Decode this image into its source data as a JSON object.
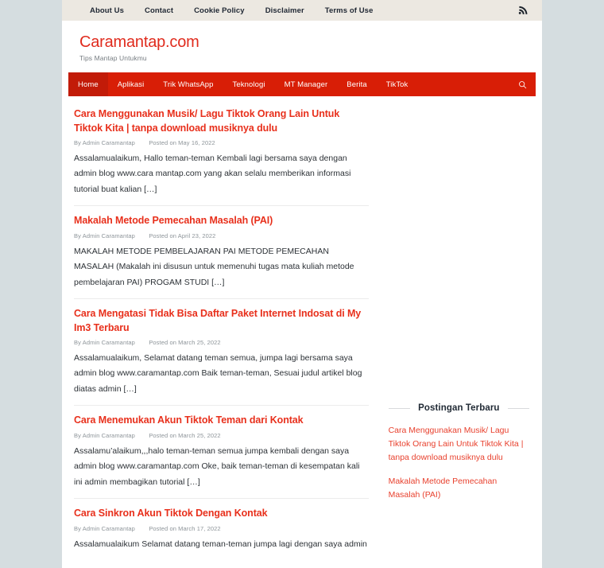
{
  "topbar": {
    "menu": [
      {
        "label": "About Us"
      },
      {
        "label": "Contact"
      },
      {
        "label": "Cookie Policy"
      },
      {
        "label": "Disclaimer"
      },
      {
        "label": "Terms of Use"
      }
    ],
    "rss_icon": "rss-icon"
  },
  "masthead": {
    "site_title": "Caramantap.com",
    "tagline": "Tips Mantap Untukmu"
  },
  "mainnav": {
    "items": [
      {
        "label": "Home",
        "active": true
      },
      {
        "label": "Aplikasi",
        "active": false
      },
      {
        "label": "Trik WhatsApp",
        "active": false
      },
      {
        "label": "Teknologi",
        "active": false
      },
      {
        "label": "MT Manager",
        "active": false
      },
      {
        "label": "Berita",
        "active": false
      },
      {
        "label": "TikTok",
        "active": false
      }
    ],
    "search_icon": "search-icon",
    "background": "#d81e06",
    "active_background": "#c21b08"
  },
  "posts": [
    {
      "title": "Cara Menggunakan Musik/ Lagu Tiktok Orang Lain Untuk Tiktok Kita | tanpa download musiknya dulu",
      "author": "By Admin Caramantap",
      "date": "Posted on May 16, 2022",
      "excerpt": "Assalamualaikum, Hallo teman-teman Kembali lagi bersama saya dengan admin blog www.cara mantap.com yang akan selalu memberikan informasi tutorial buat kalian […]"
    },
    {
      "title": "Makalah Metode Pemecahan Masalah (PAI)",
      "author": "By Admin Caramantap",
      "date": "Posted on April 23, 2022",
      "excerpt": "MAKALAH METODE PEMBELAJARAN PAI METODE PEMECAHAN MASALAH (Makalah ini disusun untuk memenuhi tugas mata kuliah metode pembelajaran PAI) PROGAM STUDI […]"
    },
    {
      "title": "Cara Mengatasi Tidak Bisa Daftar Paket Internet Indosat di My Im3 Terbaru",
      "author": "By Admin Caramantap",
      "date": "Posted on March 25, 2022",
      "excerpt": "Assalamualaikum, Selamat datang teman semua, jumpa lagi bersama saya admin blog www.caramantap.com Baik teman-teman, Sesuai judul artikel blog diatas admin […]"
    },
    {
      "title": "Cara Menemukan Akun Tiktok Teman dari Kontak",
      "author": "By Admin Caramantap",
      "date": "Posted on March 25, 2022",
      "excerpt": "Assalamu’alaikum,,,halo teman-teman semua jumpa kembali dengan saya admin blog www.caramantap.com Oke, baik teman-teman di kesempatan kali ini admin membagikan tutorial […]"
    },
    {
      "title": "Cara Sinkron Akun Tiktok Dengan Kontak",
      "author": "By Admin Caramantap",
      "date": "Posted on March 17, 2022",
      "excerpt": "Assalamualaikum Selamat datang teman-teman jumpa lagi dengan saya admin"
    }
  ],
  "sidebar": {
    "widget_title": "Postingan Terbaru",
    "recent_posts": [
      {
        "label": "Cara Menggunakan Musik/ Lagu Tiktok Orang Lain Untuk Tiktok Kita | tanpa download musiknya dulu"
      },
      {
        "label": "Makalah Metode Pemecahan Masalah (PAI)"
      }
    ]
  },
  "colors": {
    "brand_red": "#e02b1d",
    "nav_red": "#d81e06",
    "page_background": "#d5dde0",
    "topbar_background": "#ece8e1"
  }
}
